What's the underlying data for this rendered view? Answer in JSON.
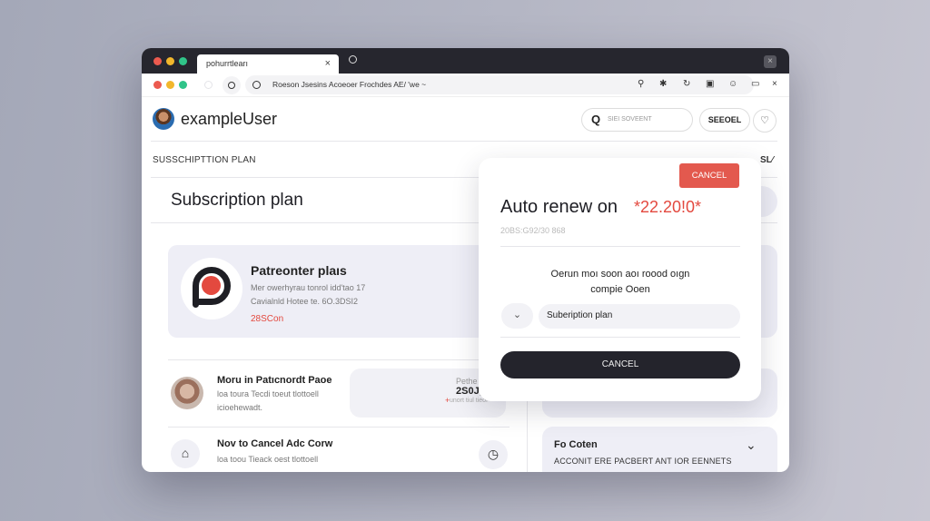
{
  "browser": {
    "tab_title": "pohurrtlearı",
    "tab_close": "×",
    "window_close": "×",
    "address_text": "Roeson Jsesins Acoeoer Frochdes AE/ 'we ~",
    "colors": {
      "red": "#ec5a4f",
      "yellow": "#f2b72c",
      "green": "#30c489"
    }
  },
  "header": {
    "username": "exampleUser",
    "search_placeholder": "SIEI SOVEENT",
    "search_icon": "Q",
    "select_label": "SEEOEL",
    "profile_icon": "♡"
  },
  "main": {
    "section_label": "SUSSCHIPTTION PLAN",
    "section_label_right": "SL⁄",
    "page_title": "Subscription plan",
    "plan": {
      "title": "Patreonter plaıs",
      "desc_line1": "Mer owerhyrau tonrol idd'tao 17",
      "desc_line2": "Cavialnld Hotee te. 6O.3DSI2",
      "price": "28SCon"
    },
    "list": [
      {
        "title": "Moru in Patıcnordt Paoe",
        "sub1": "loa toura Tecdi toeut tlottoell",
        "sub2": "icioehewadt.",
        "price_label": "Pethe",
        "price_value": "2S0J,",
        "price_note": "unort tiul tieor"
      },
      {
        "title": "Nov to Cancel Adc Corw",
        "sub1": "loa toou Tieack oest tlottoell"
      }
    ],
    "faq": {
      "title": "Fo Coten",
      "sub": "ACCONIT ERE PACBERT ANT IOR EENNETS"
    }
  },
  "modal": {
    "cancel_top_label": "CANCEL",
    "title": "Auto renew on",
    "amount": "*22.20!0*",
    "date": "20BS:G92/30 868",
    "body_line1": "Oerun moı soon aoı roood oıgn",
    "body_line2": "compie Ooen",
    "select_value": "Subeription plan",
    "cancel_main_label": "CANCEL",
    "accent_color": "#e3594e"
  }
}
